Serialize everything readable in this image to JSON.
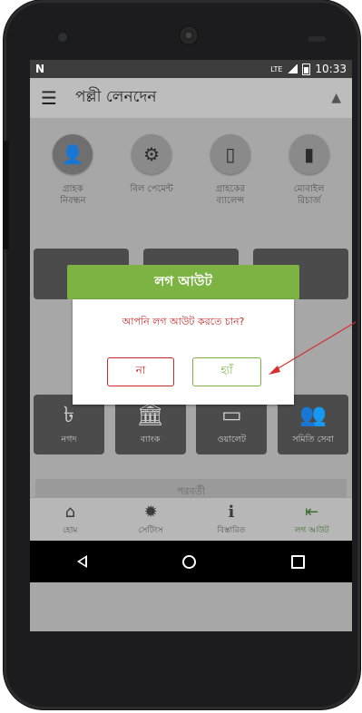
{
  "status_bar": {
    "left_icon": "N",
    "network": "LTE",
    "time": "10:33"
  },
  "app_bar": {
    "title": "পল্লী লেনদেন",
    "menu_icon": "hamburger-icon",
    "notification_icon": "bell-icon"
  },
  "services": [
    {
      "label_line1": "গ্রাহক",
      "label_line2": "নিবন্ধন",
      "icon": "add-user-icon"
    },
    {
      "label_line1": "বিল পেমেন্ট",
      "label_line2": "",
      "icon": "bill-payment-icon"
    },
    {
      "label_line1": "গ্রাহকের",
      "label_line2": "ব্যালেন্স",
      "icon": "balance-icon"
    },
    {
      "label_line1": "মোবাইল",
      "label_line2": "রিচার্জ",
      "icon": "mobile-recharge-icon"
    }
  ],
  "payment_methods": [
    {
      "label": "নগদ",
      "icon": "taka-icon"
    },
    {
      "label": "ব্যাংক",
      "icon": "bank-icon"
    },
    {
      "label": "ওয়ালেট",
      "icon": "wallet-icon"
    },
    {
      "label": "সমিতি সেবা",
      "icon": "group-icon"
    }
  ],
  "next_button": "পরবর্তী",
  "tabs": [
    {
      "label": "হোম",
      "icon": "home-icon",
      "active": false
    },
    {
      "label": "সেটিংস",
      "icon": "settings-icon",
      "active": false
    },
    {
      "label": "বিস্তারিত",
      "icon": "info-icon",
      "active": false
    },
    {
      "label": "লগ আউট",
      "icon": "logout-icon",
      "active": true
    }
  ],
  "dialog": {
    "title": "লগ আউট",
    "message": "আপনি লগ আউট করতে চান?",
    "no_label": "না",
    "yes_label": "হ্যাঁ"
  },
  "colors": {
    "accent_green": "#7cb342",
    "danger_red": "#c62828",
    "active_tab": "#3c6e2f"
  }
}
